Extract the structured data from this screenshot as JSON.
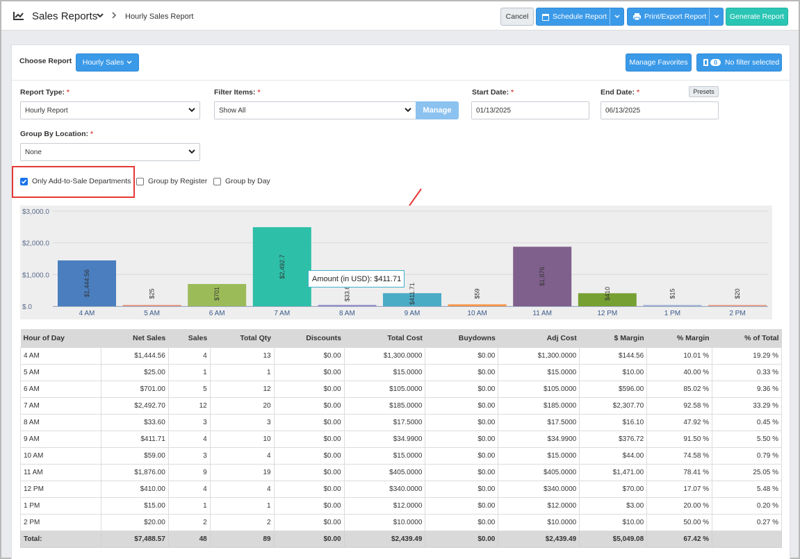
{
  "header": {
    "title": "Sales Reports",
    "breadcrumb": "Hourly Sales Report",
    "cancel_label": "Cancel",
    "schedule_label": "Schedule Report",
    "print_label": "Print/Export Report",
    "generate_label": "Generate Report"
  },
  "report": {
    "choose_label": "Choose Report",
    "choose_value": "Hourly Sales",
    "manage_favorites_label": "Manage Favorites",
    "filter_count": "0",
    "no_filter_label": "No filter selected"
  },
  "form": {
    "report_type_label": "Report Type:",
    "report_type_value": "Hourly Report",
    "filter_items_label": "Filter Items:",
    "filter_items_value": "Show All",
    "manage_label": "Manage",
    "start_date_label": "Start Date:",
    "start_date_value": "01/13/2025",
    "end_date_label": "End Date:",
    "end_date_value": "06/13/2025",
    "presets_label": "Presets",
    "group_by_location_label": "Group By Location:",
    "group_by_location_value": "None",
    "required_mark": "*"
  },
  "options": [
    {
      "label": "Only Add-to-Sale Departments",
      "checked": true
    },
    {
      "label": "Group by Register",
      "checked": false
    },
    {
      "label": "Group by Day",
      "checked": false
    }
  ],
  "tooltip": "Amount (in USD): $411.71",
  "colors": {
    "accent_blue": "#3b9ae8",
    "accent_teal": "#2bc5b4",
    "highlight_red": "#e53935"
  },
  "chart_data": {
    "type": "bar",
    "y_ticks": [
      "$3,000.0",
      "$2,000.0",
      "$1,000.0",
      "$.0"
    ],
    "ylim": [
      0,
      3000
    ],
    "grid": true,
    "categories": [
      "4 AM",
      "5 AM",
      "6 AM",
      "7 AM",
      "8 AM",
      "9 AM",
      "10 AM",
      "11 AM",
      "12 PM",
      "1 PM",
      "2 PM"
    ],
    "values": [
      1444.56,
      25,
      701,
      2492.7,
      33.6,
      411.71,
      59,
      1876,
      410,
      15,
      20
    ],
    "labels": [
      "$1,444.56",
      "$25",
      "$701",
      "$2,492.7",
      "$33.6",
      "$411.71",
      "$59",
      "$1,876",
      "$410",
      "$15",
      "$20"
    ],
    "colors": [
      "#4a7ebf",
      "#e79a8a",
      "#9bbb59",
      "#2dbfa8",
      "#9c92c9",
      "#4bacc6",
      "#f79646",
      "#7f5f8c",
      "#77a033",
      "#a6b9d6",
      "#e6a48f"
    ]
  },
  "table": {
    "headers": [
      "Hour of Day",
      "Net Sales",
      "Sales",
      "Total Qty",
      "Discounts",
      "Total Cost",
      "Buydowns",
      "Adj Cost",
      "$ Margin",
      "% Margin",
      "% of Total"
    ],
    "rows": [
      [
        "4 AM",
        "$1,444.56",
        "4",
        "13",
        "$0.00",
        "$1,300.0000",
        "$0.00",
        "$1,300.0000",
        "$144.56",
        "10.01 %",
        "19.29 %"
      ],
      [
        "5 AM",
        "$25.00",
        "1",
        "1",
        "$0.00",
        "$15.0000",
        "$0.00",
        "$15.0000",
        "$10.00",
        "40.00 %",
        "0.33 %"
      ],
      [
        "6 AM",
        "$701.00",
        "5",
        "12",
        "$0.00",
        "$105.0000",
        "$0.00",
        "$105.0000",
        "$596.00",
        "85.02 %",
        "9.36 %"
      ],
      [
        "7 AM",
        "$2,492.70",
        "12",
        "20",
        "$0.00",
        "$185.0000",
        "$0.00",
        "$185.0000",
        "$2,307.70",
        "92.58 %",
        "33.29 %"
      ],
      [
        "8 AM",
        "$33.60",
        "3",
        "3",
        "$0.00",
        "$17.5000",
        "$0.00",
        "$17.5000",
        "$16.10",
        "47.92 %",
        "0.45 %"
      ],
      [
        "9 AM",
        "$411.71",
        "4",
        "10",
        "$0.00",
        "$34.9900",
        "$0.00",
        "$34.9900",
        "$376.72",
        "91.50 %",
        "5.50 %"
      ],
      [
        "10 AM",
        "$59.00",
        "3",
        "4",
        "$0.00",
        "$15.0000",
        "$0.00",
        "$15.0000",
        "$44.00",
        "74.58 %",
        "0.79 %"
      ],
      [
        "11 AM",
        "$1,876.00",
        "9",
        "19",
        "$0.00",
        "$405.0000",
        "$0.00",
        "$405.0000",
        "$1,471.00",
        "78.41 %",
        "25.05 %"
      ],
      [
        "12 PM",
        "$410.00",
        "4",
        "4",
        "$0.00",
        "$340.0000",
        "$0.00",
        "$340.0000",
        "$70.00",
        "17.07 %",
        "5.48 %"
      ],
      [
        "1 PM",
        "$15.00",
        "1",
        "1",
        "$0.00",
        "$12.0000",
        "$0.00",
        "$12.0000",
        "$3.00",
        "20.00 %",
        "0.20 %"
      ],
      [
        "2 PM",
        "$20.00",
        "2",
        "2",
        "$0.00",
        "$10.0000",
        "$0.00",
        "$10.0000",
        "$10.00",
        "50.00 %",
        "0.27 %"
      ]
    ],
    "total": [
      "Total:",
      "$7,488.57",
      "48",
      "89",
      "$0.00",
      "$2,439.49",
      "$0.00",
      "$2,439.49",
      "$5,049.08",
      "67.42 %",
      ""
    ]
  }
}
